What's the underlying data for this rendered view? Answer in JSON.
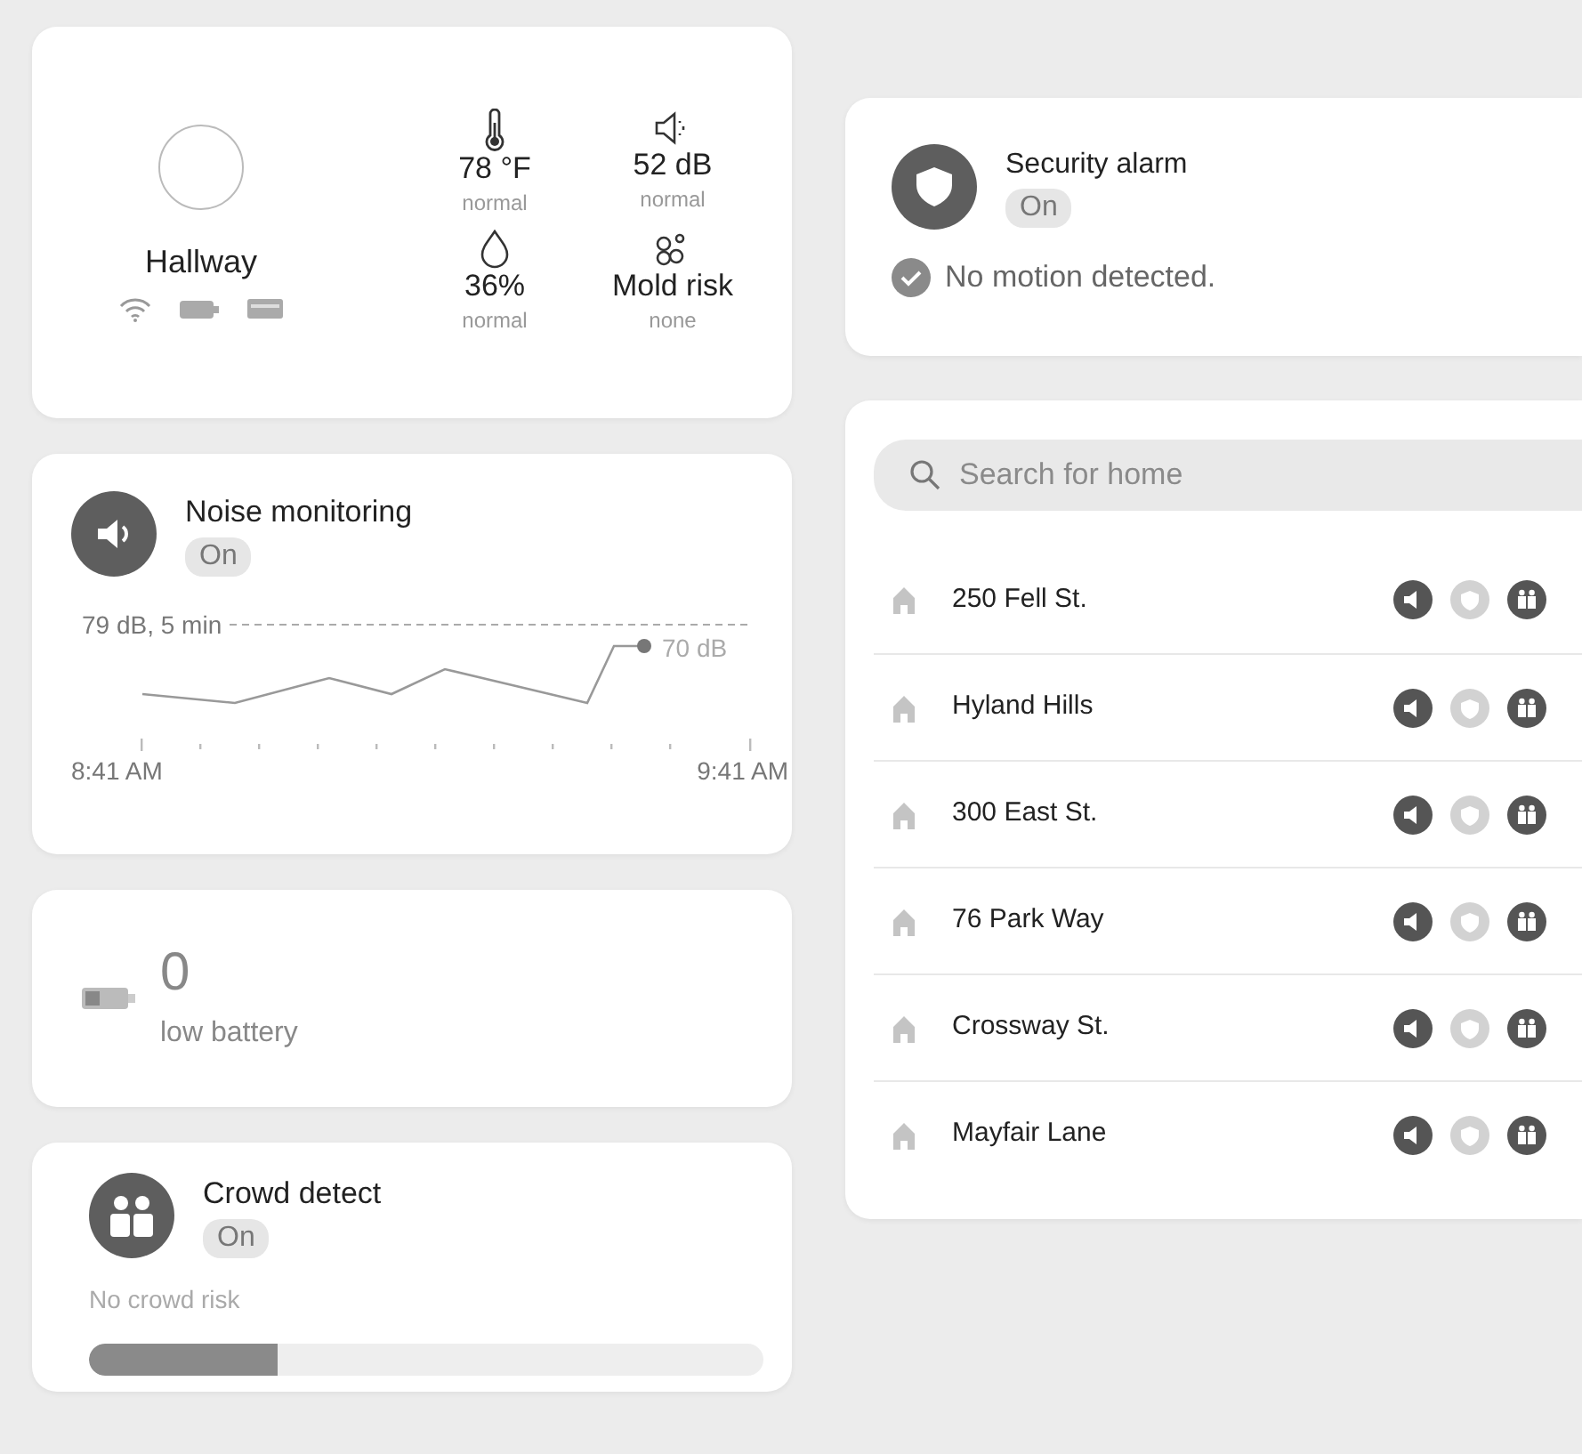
{
  "hallway": {
    "name": "Hallway",
    "sensors": [
      {
        "kind": "temperature",
        "value": "78 °F",
        "status": "normal"
      },
      {
        "kind": "noise",
        "value": "52 dB",
        "status": "normal"
      },
      {
        "kind": "humidity",
        "value": "36%",
        "status": "normal"
      },
      {
        "kind": "mold",
        "value": "Mold risk",
        "status": "none"
      }
    ]
  },
  "noise_monitoring": {
    "title": "Noise monitoring",
    "state": "On",
    "threshold_label": "79 dB, 5 min",
    "current_label": "70 dB",
    "start_time": "8:41 AM",
    "end_time": "9:41 AM"
  },
  "battery": {
    "value": "0",
    "label": "low battery"
  },
  "crowd_detect": {
    "title": "Crowd detect",
    "state": "On",
    "status": "No crowd risk",
    "level": 0.28
  },
  "security_alarm": {
    "title": "Security alarm",
    "state": "On",
    "message": "No motion detected."
  },
  "search": {
    "placeholder": "Search for home"
  },
  "homes": [
    {
      "name": "250 Fell St.",
      "alerts": [
        {
          "kind": "noise",
          "on": true
        },
        {
          "kind": "security",
          "on": false
        },
        {
          "kind": "crowd",
          "on": true
        }
      ]
    },
    {
      "name": "Hyland Hills",
      "alerts": [
        {
          "kind": "noise",
          "on": true
        },
        {
          "kind": "security",
          "on": false
        },
        {
          "kind": "crowd",
          "on": true
        }
      ]
    },
    {
      "name": "300 East St.",
      "alerts": [
        {
          "kind": "noise",
          "on": true
        },
        {
          "kind": "security",
          "on": false
        },
        {
          "kind": "crowd",
          "on": true
        }
      ]
    },
    {
      "name": "76 Park Way",
      "alerts": [
        {
          "kind": "noise",
          "on": true
        },
        {
          "kind": "security",
          "on": false
        },
        {
          "kind": "crowd",
          "on": true
        }
      ]
    },
    {
      "name": "Crossway St.",
      "alerts": [
        {
          "kind": "noise",
          "on": true
        },
        {
          "kind": "security",
          "on": false
        },
        {
          "kind": "crowd",
          "on": true
        }
      ]
    },
    {
      "name": "Mayfair Lane",
      "alerts": [
        {
          "kind": "noise",
          "on": true
        },
        {
          "kind": "security",
          "on": false
        },
        {
          "kind": "crowd",
          "on": true
        }
      ]
    }
  ]
}
